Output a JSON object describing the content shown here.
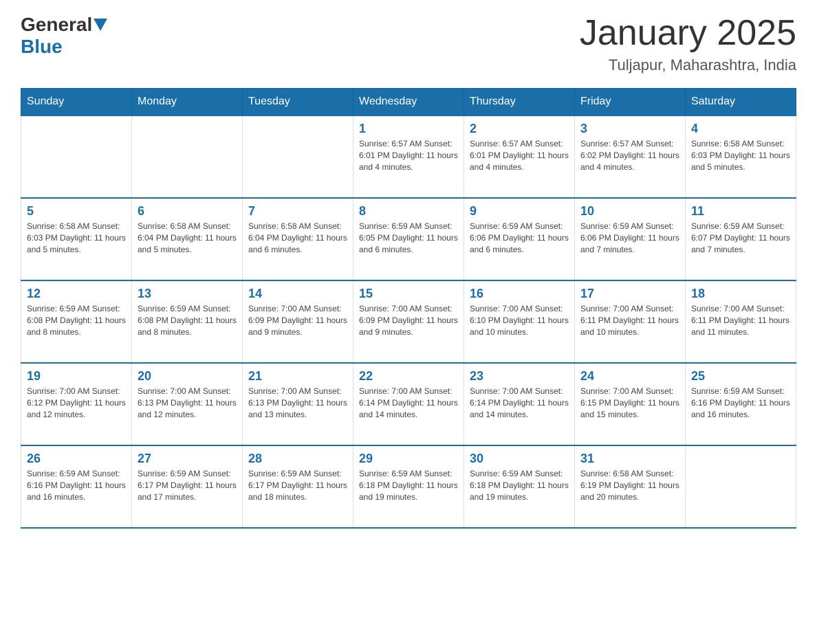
{
  "header": {
    "logo_general": "General",
    "logo_blue": "Blue",
    "month_title": "January 2025",
    "location": "Tuljapur, Maharashtra, India"
  },
  "days_of_week": [
    "Sunday",
    "Monday",
    "Tuesday",
    "Wednesday",
    "Thursday",
    "Friday",
    "Saturday"
  ],
  "weeks": [
    [
      {
        "day": "",
        "info": ""
      },
      {
        "day": "",
        "info": ""
      },
      {
        "day": "",
        "info": ""
      },
      {
        "day": "1",
        "info": "Sunrise: 6:57 AM\nSunset: 6:01 PM\nDaylight: 11 hours and 4 minutes."
      },
      {
        "day": "2",
        "info": "Sunrise: 6:57 AM\nSunset: 6:01 PM\nDaylight: 11 hours and 4 minutes."
      },
      {
        "day": "3",
        "info": "Sunrise: 6:57 AM\nSunset: 6:02 PM\nDaylight: 11 hours and 4 minutes."
      },
      {
        "day": "4",
        "info": "Sunrise: 6:58 AM\nSunset: 6:03 PM\nDaylight: 11 hours and 5 minutes."
      }
    ],
    [
      {
        "day": "5",
        "info": "Sunrise: 6:58 AM\nSunset: 6:03 PM\nDaylight: 11 hours and 5 minutes."
      },
      {
        "day": "6",
        "info": "Sunrise: 6:58 AM\nSunset: 6:04 PM\nDaylight: 11 hours and 5 minutes."
      },
      {
        "day": "7",
        "info": "Sunrise: 6:58 AM\nSunset: 6:04 PM\nDaylight: 11 hours and 6 minutes."
      },
      {
        "day": "8",
        "info": "Sunrise: 6:59 AM\nSunset: 6:05 PM\nDaylight: 11 hours and 6 minutes."
      },
      {
        "day": "9",
        "info": "Sunrise: 6:59 AM\nSunset: 6:06 PM\nDaylight: 11 hours and 6 minutes."
      },
      {
        "day": "10",
        "info": "Sunrise: 6:59 AM\nSunset: 6:06 PM\nDaylight: 11 hours and 7 minutes."
      },
      {
        "day": "11",
        "info": "Sunrise: 6:59 AM\nSunset: 6:07 PM\nDaylight: 11 hours and 7 minutes."
      }
    ],
    [
      {
        "day": "12",
        "info": "Sunrise: 6:59 AM\nSunset: 6:08 PM\nDaylight: 11 hours and 8 minutes."
      },
      {
        "day": "13",
        "info": "Sunrise: 6:59 AM\nSunset: 6:08 PM\nDaylight: 11 hours and 8 minutes."
      },
      {
        "day": "14",
        "info": "Sunrise: 7:00 AM\nSunset: 6:09 PM\nDaylight: 11 hours and 9 minutes."
      },
      {
        "day": "15",
        "info": "Sunrise: 7:00 AM\nSunset: 6:09 PM\nDaylight: 11 hours and 9 minutes."
      },
      {
        "day": "16",
        "info": "Sunrise: 7:00 AM\nSunset: 6:10 PM\nDaylight: 11 hours and 10 minutes."
      },
      {
        "day": "17",
        "info": "Sunrise: 7:00 AM\nSunset: 6:11 PM\nDaylight: 11 hours and 10 minutes."
      },
      {
        "day": "18",
        "info": "Sunrise: 7:00 AM\nSunset: 6:11 PM\nDaylight: 11 hours and 11 minutes."
      }
    ],
    [
      {
        "day": "19",
        "info": "Sunrise: 7:00 AM\nSunset: 6:12 PM\nDaylight: 11 hours and 12 minutes."
      },
      {
        "day": "20",
        "info": "Sunrise: 7:00 AM\nSunset: 6:13 PM\nDaylight: 11 hours and 12 minutes."
      },
      {
        "day": "21",
        "info": "Sunrise: 7:00 AM\nSunset: 6:13 PM\nDaylight: 11 hours and 13 minutes."
      },
      {
        "day": "22",
        "info": "Sunrise: 7:00 AM\nSunset: 6:14 PM\nDaylight: 11 hours and 14 minutes."
      },
      {
        "day": "23",
        "info": "Sunrise: 7:00 AM\nSunset: 6:14 PM\nDaylight: 11 hours and 14 minutes."
      },
      {
        "day": "24",
        "info": "Sunrise: 7:00 AM\nSunset: 6:15 PM\nDaylight: 11 hours and 15 minutes."
      },
      {
        "day": "25",
        "info": "Sunrise: 6:59 AM\nSunset: 6:16 PM\nDaylight: 11 hours and 16 minutes."
      }
    ],
    [
      {
        "day": "26",
        "info": "Sunrise: 6:59 AM\nSunset: 6:16 PM\nDaylight: 11 hours and 16 minutes."
      },
      {
        "day": "27",
        "info": "Sunrise: 6:59 AM\nSunset: 6:17 PM\nDaylight: 11 hours and 17 minutes."
      },
      {
        "day": "28",
        "info": "Sunrise: 6:59 AM\nSunset: 6:17 PM\nDaylight: 11 hours and 18 minutes."
      },
      {
        "day": "29",
        "info": "Sunrise: 6:59 AM\nSunset: 6:18 PM\nDaylight: 11 hours and 19 minutes."
      },
      {
        "day": "30",
        "info": "Sunrise: 6:59 AM\nSunset: 6:18 PM\nDaylight: 11 hours and 19 minutes."
      },
      {
        "day": "31",
        "info": "Sunrise: 6:58 AM\nSunset: 6:19 PM\nDaylight: 11 hours and 20 minutes."
      },
      {
        "day": "",
        "info": ""
      }
    ]
  ]
}
